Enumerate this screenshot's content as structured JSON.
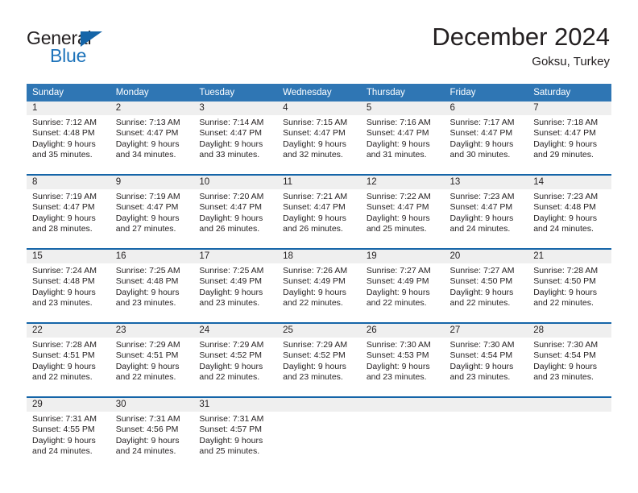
{
  "brand": {
    "name_top": "General",
    "name_bottom": "Blue",
    "accent_color": "#1d73ba",
    "triangle_color": "#1565a8"
  },
  "header": {
    "title": "December 2024",
    "subtitle": "Goksu, Turkey"
  },
  "calendar": {
    "header_bg": "#2f76b4",
    "daynum_bg": "#efefef",
    "rule_color": "#1565a8",
    "weekdays": [
      "Sunday",
      "Monday",
      "Tuesday",
      "Wednesday",
      "Thursday",
      "Friday",
      "Saturday"
    ],
    "weeks": [
      [
        {
          "day": "1",
          "sunrise": "Sunrise: 7:12 AM",
          "sunset": "Sunset: 4:48 PM",
          "daylight_line1": "Daylight: 9 hours",
          "daylight_line2": "and 35 minutes."
        },
        {
          "day": "2",
          "sunrise": "Sunrise: 7:13 AM",
          "sunset": "Sunset: 4:47 PM",
          "daylight_line1": "Daylight: 9 hours",
          "daylight_line2": "and 34 minutes."
        },
        {
          "day": "3",
          "sunrise": "Sunrise: 7:14 AM",
          "sunset": "Sunset: 4:47 PM",
          "daylight_line1": "Daylight: 9 hours",
          "daylight_line2": "and 33 minutes."
        },
        {
          "day": "4",
          "sunrise": "Sunrise: 7:15 AM",
          "sunset": "Sunset: 4:47 PM",
          "daylight_line1": "Daylight: 9 hours",
          "daylight_line2": "and 32 minutes."
        },
        {
          "day": "5",
          "sunrise": "Sunrise: 7:16 AM",
          "sunset": "Sunset: 4:47 PM",
          "daylight_line1": "Daylight: 9 hours",
          "daylight_line2": "and 31 minutes."
        },
        {
          "day": "6",
          "sunrise": "Sunrise: 7:17 AM",
          "sunset": "Sunset: 4:47 PM",
          "daylight_line1": "Daylight: 9 hours",
          "daylight_line2": "and 30 minutes."
        },
        {
          "day": "7",
          "sunrise": "Sunrise: 7:18 AM",
          "sunset": "Sunset: 4:47 PM",
          "daylight_line1": "Daylight: 9 hours",
          "daylight_line2": "and 29 minutes."
        }
      ],
      [
        {
          "day": "8",
          "sunrise": "Sunrise: 7:19 AM",
          "sunset": "Sunset: 4:47 PM",
          "daylight_line1": "Daylight: 9 hours",
          "daylight_line2": "and 28 minutes."
        },
        {
          "day": "9",
          "sunrise": "Sunrise: 7:19 AM",
          "sunset": "Sunset: 4:47 PM",
          "daylight_line1": "Daylight: 9 hours",
          "daylight_line2": "and 27 minutes."
        },
        {
          "day": "10",
          "sunrise": "Sunrise: 7:20 AM",
          "sunset": "Sunset: 4:47 PM",
          "daylight_line1": "Daylight: 9 hours",
          "daylight_line2": "and 26 minutes."
        },
        {
          "day": "11",
          "sunrise": "Sunrise: 7:21 AM",
          "sunset": "Sunset: 4:47 PM",
          "daylight_line1": "Daylight: 9 hours",
          "daylight_line2": "and 26 minutes."
        },
        {
          "day": "12",
          "sunrise": "Sunrise: 7:22 AM",
          "sunset": "Sunset: 4:47 PM",
          "daylight_line1": "Daylight: 9 hours",
          "daylight_line2": "and 25 minutes."
        },
        {
          "day": "13",
          "sunrise": "Sunrise: 7:23 AM",
          "sunset": "Sunset: 4:47 PM",
          "daylight_line1": "Daylight: 9 hours",
          "daylight_line2": "and 24 minutes."
        },
        {
          "day": "14",
          "sunrise": "Sunrise: 7:23 AM",
          "sunset": "Sunset: 4:48 PM",
          "daylight_line1": "Daylight: 9 hours",
          "daylight_line2": "and 24 minutes."
        }
      ],
      [
        {
          "day": "15",
          "sunrise": "Sunrise: 7:24 AM",
          "sunset": "Sunset: 4:48 PM",
          "daylight_line1": "Daylight: 9 hours",
          "daylight_line2": "and 23 minutes."
        },
        {
          "day": "16",
          "sunrise": "Sunrise: 7:25 AM",
          "sunset": "Sunset: 4:48 PM",
          "daylight_line1": "Daylight: 9 hours",
          "daylight_line2": "and 23 minutes."
        },
        {
          "day": "17",
          "sunrise": "Sunrise: 7:25 AM",
          "sunset": "Sunset: 4:49 PM",
          "daylight_line1": "Daylight: 9 hours",
          "daylight_line2": "and 23 minutes."
        },
        {
          "day": "18",
          "sunrise": "Sunrise: 7:26 AM",
          "sunset": "Sunset: 4:49 PM",
          "daylight_line1": "Daylight: 9 hours",
          "daylight_line2": "and 22 minutes."
        },
        {
          "day": "19",
          "sunrise": "Sunrise: 7:27 AM",
          "sunset": "Sunset: 4:49 PM",
          "daylight_line1": "Daylight: 9 hours",
          "daylight_line2": "and 22 minutes."
        },
        {
          "day": "20",
          "sunrise": "Sunrise: 7:27 AM",
          "sunset": "Sunset: 4:50 PM",
          "daylight_line1": "Daylight: 9 hours",
          "daylight_line2": "and 22 minutes."
        },
        {
          "day": "21",
          "sunrise": "Sunrise: 7:28 AM",
          "sunset": "Sunset: 4:50 PM",
          "daylight_line1": "Daylight: 9 hours",
          "daylight_line2": "and 22 minutes."
        }
      ],
      [
        {
          "day": "22",
          "sunrise": "Sunrise: 7:28 AM",
          "sunset": "Sunset: 4:51 PM",
          "daylight_line1": "Daylight: 9 hours",
          "daylight_line2": "and 22 minutes."
        },
        {
          "day": "23",
          "sunrise": "Sunrise: 7:29 AM",
          "sunset": "Sunset: 4:51 PM",
          "daylight_line1": "Daylight: 9 hours",
          "daylight_line2": "and 22 minutes."
        },
        {
          "day": "24",
          "sunrise": "Sunrise: 7:29 AM",
          "sunset": "Sunset: 4:52 PM",
          "daylight_line1": "Daylight: 9 hours",
          "daylight_line2": "and 22 minutes."
        },
        {
          "day": "25",
          "sunrise": "Sunrise: 7:29 AM",
          "sunset": "Sunset: 4:52 PM",
          "daylight_line1": "Daylight: 9 hours",
          "daylight_line2": "and 23 minutes."
        },
        {
          "day": "26",
          "sunrise": "Sunrise: 7:30 AM",
          "sunset": "Sunset: 4:53 PM",
          "daylight_line1": "Daylight: 9 hours",
          "daylight_line2": "and 23 minutes."
        },
        {
          "day": "27",
          "sunrise": "Sunrise: 7:30 AM",
          "sunset": "Sunset: 4:54 PM",
          "daylight_line1": "Daylight: 9 hours",
          "daylight_line2": "and 23 minutes."
        },
        {
          "day": "28",
          "sunrise": "Sunrise: 7:30 AM",
          "sunset": "Sunset: 4:54 PM",
          "daylight_line1": "Daylight: 9 hours",
          "daylight_line2": "and 23 minutes."
        }
      ],
      [
        {
          "day": "29",
          "sunrise": "Sunrise: 7:31 AM",
          "sunset": "Sunset: 4:55 PM",
          "daylight_line1": "Daylight: 9 hours",
          "daylight_line2": "and 24 minutes."
        },
        {
          "day": "30",
          "sunrise": "Sunrise: 7:31 AM",
          "sunset": "Sunset: 4:56 PM",
          "daylight_line1": "Daylight: 9 hours",
          "daylight_line2": "and 24 minutes."
        },
        {
          "day": "31",
          "sunrise": "Sunrise: 7:31 AM",
          "sunset": "Sunset: 4:57 PM",
          "daylight_line1": "Daylight: 9 hours",
          "daylight_line2": "and 25 minutes."
        },
        {
          "day": "",
          "sunrise": "",
          "sunset": "",
          "daylight_line1": "",
          "daylight_line2": ""
        },
        {
          "day": "",
          "sunrise": "",
          "sunset": "",
          "daylight_line1": "",
          "daylight_line2": ""
        },
        {
          "day": "",
          "sunrise": "",
          "sunset": "",
          "daylight_line1": "",
          "daylight_line2": ""
        },
        {
          "day": "",
          "sunrise": "",
          "sunset": "",
          "daylight_line1": "",
          "daylight_line2": ""
        }
      ]
    ]
  }
}
